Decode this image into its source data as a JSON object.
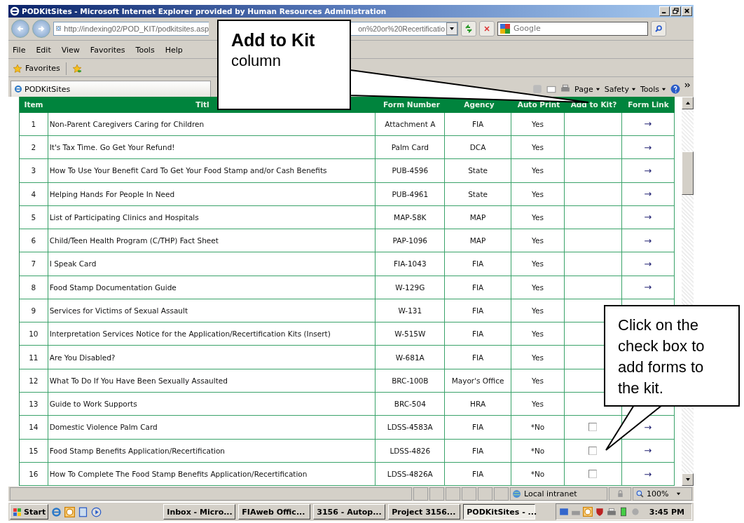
{
  "window": {
    "title": "PODKitSites - Microsoft Internet Explorer provided by Human Resources Administration"
  },
  "address_bar": {
    "url_start": "http://indexing02/POD_KIT/podkitsites.asp",
    "url_end": "on%20or%20Recertificatio"
  },
  "search": {
    "placeholder": "Google"
  },
  "menu": [
    "File",
    "Edit",
    "View",
    "Favorites",
    "Tools",
    "Help"
  ],
  "favorites_bar": {
    "label": "Favorites"
  },
  "tab": {
    "label": "PODKitSites"
  },
  "command_bar": [
    "Page",
    "Safety",
    "Tools"
  ],
  "table": {
    "columns": [
      "Item",
      "Titl",
      "Form Number",
      "Agency",
      "Auto Print",
      "Add to Kit?",
      "Form Link"
    ],
    "rows": [
      {
        "item": "1",
        "title": "Non-Parent Caregivers Caring for Children",
        "form": "Attachment A",
        "agency": "FIA",
        "auto_print": "Yes",
        "link": "→"
      },
      {
        "item": "2",
        "title": "It's Tax Time. Go Get Your Refund!",
        "form": "Palm Card",
        "agency": "DCA",
        "auto_print": "Yes",
        "link": "→"
      },
      {
        "item": "3",
        "title": "How To Use Your Benefit Card To Get Your Food Stamp and/or Cash Benefits",
        "form": "PUB-4596",
        "agency": "State",
        "auto_print": "Yes",
        "link": "→"
      },
      {
        "item": "4",
        "title": "Helping Hands For People In Need",
        "form": "PUB-4961",
        "agency": "State",
        "auto_print": "Yes",
        "link": "→"
      },
      {
        "item": "5",
        "title": "List of Participating Clinics and Hospitals",
        "form": "MAP-58K",
        "agency": "MAP",
        "auto_print": "Yes",
        "link": "→"
      },
      {
        "item": "6",
        "title": "Child/Teen Health Program (C/THP) Fact Sheet",
        "form": "PAP-1096",
        "agency": "MAP",
        "auto_print": "Yes",
        "link": "→"
      },
      {
        "item": "7",
        "title": "I Speak Card",
        "form": "FIA-1043",
        "agency": "FIA",
        "auto_print": "Yes",
        "link": "→"
      },
      {
        "item": "8",
        "title": "Food Stamp Documentation Guide",
        "form": "W-129G",
        "agency": "FIA",
        "auto_print": "Yes",
        "link": "→"
      },
      {
        "item": "9",
        "title": "Services for Victims of Sexual Assault",
        "form": "W-131",
        "agency": "FIA",
        "auto_print": "Yes"
      },
      {
        "item": "10",
        "title": "Interpretation Services Notice for the Application/Recertification Kits (Insert)",
        "form": "W-515W",
        "agency": "FIA",
        "auto_print": "Yes"
      },
      {
        "item": "11",
        "title": "Are You Disabled?",
        "form": "W-681A",
        "agency": "FIA",
        "auto_print": "Yes"
      },
      {
        "item": "12",
        "title": "What To Do If You Have Been Sexually Assaulted",
        "form": "BRC-100B",
        "agency": "Mayor's Office",
        "auto_print": "Yes"
      },
      {
        "item": "13",
        "title": "Guide to Work Supports",
        "form": "BRC-504",
        "agency": "HRA",
        "auto_print": "Yes"
      },
      {
        "item": "14",
        "title": "Domestic Violence Palm Card",
        "form": "LDSS-4583A",
        "agency": "FIA",
        "auto_print": "*No",
        "add_to_kit": {
          "checked": false
        },
        "link": "→"
      },
      {
        "item": "15",
        "title": "Food Stamp Benefits Application/Recertification",
        "form": "LDSS-4826",
        "agency": "FIA",
        "auto_print": "*No",
        "add_to_kit": {
          "checked": false
        },
        "link": "→"
      },
      {
        "item": "16",
        "title": "How To Complete The Food Stamp Benefits Application/Recertification",
        "form": "LDSS-4826A",
        "agency": "FIA",
        "auto_print": "*No",
        "add_to_kit": {
          "checked": false
        },
        "link": "→"
      }
    ]
  },
  "status_bar": {
    "zone": "Local intranet",
    "zoom": "100%"
  },
  "taskbar": {
    "start": "Start",
    "tasks": [
      {
        "label": "Inbox - Micro...",
        "selected": false
      },
      {
        "label": "FIAweb Offic...",
        "selected": false
      },
      {
        "label": "3156 - Autop...",
        "selected": false
      },
      {
        "label": "Project 3156...",
        "selected": false
      },
      {
        "label": "PODKitSites - ...",
        "selected": true
      }
    ],
    "clock": "3:45 PM"
  },
  "callouts": [
    {
      "title": "Add to Kit",
      "text": "column"
    },
    {
      "text": "Click on the check box to add forms to the kit."
    }
  ]
}
